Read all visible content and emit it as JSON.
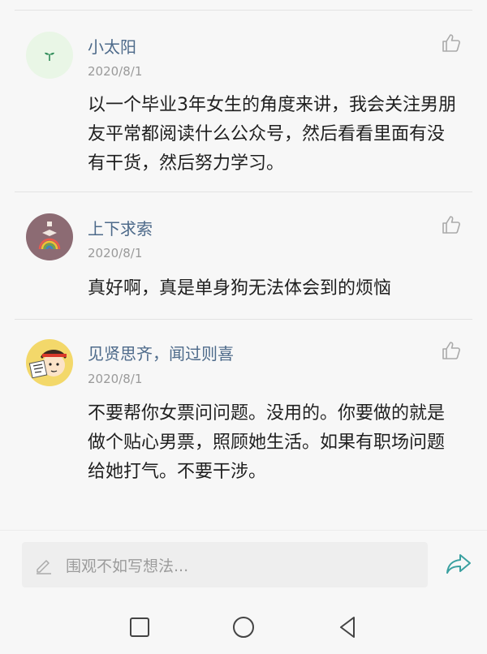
{
  "comments": [
    {
      "name": "小太阳",
      "date": "2020/8/1",
      "text": "以一个毕业3年女生的角度来讲，我会关注男朋友平常都阅读什么公众号，然后看看里面有没有干货，然后努力学习。"
    },
    {
      "name": "上下求索",
      "date": "2020/8/1",
      "text": "真好啊，真是单身狗无法体会到的烦恼"
    },
    {
      "name": "见贤思齐，闻过则喜",
      "date": "2020/8/1",
      "text": "不要帮你女票问问题。没用的。你要做的就是做个贴心男票，照顾她生活。如果有职场问题给她打气。不要干涉。"
    }
  ],
  "input": {
    "placeholder": "围观不如写想法..."
  },
  "icons": {
    "like": "thumbs-up-icon",
    "pencil": "pencil-icon",
    "send": "share-arrow-icon",
    "nav": [
      "square-recents-icon",
      "circle-home-icon",
      "triangle-back-icon"
    ]
  },
  "colors": {
    "name": "#4d6a8a",
    "send": "#3aa0a0",
    "sprout": "#2e8b57"
  }
}
